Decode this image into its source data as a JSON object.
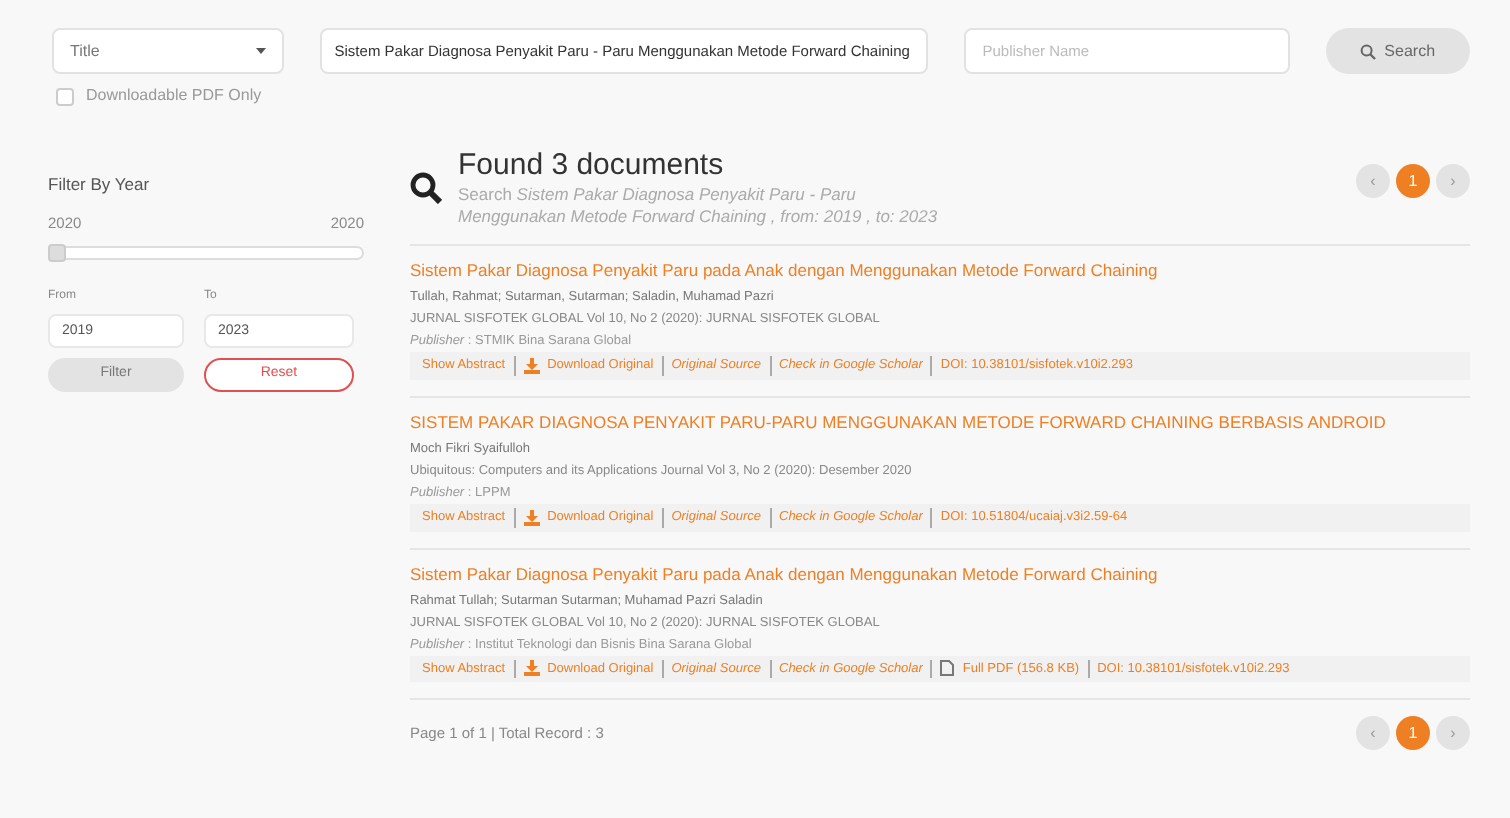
{
  "search_bar": {
    "field_select": "Title",
    "query": "Sistem Pakar Diagnosa Penyakit Paru - Paru Menggunakan Metode Forward Chaining",
    "publisher_placeholder": "Publisher Name",
    "button": "Search"
  },
  "pdf_only": {
    "label": "Downloadable PDF Only",
    "checked": false
  },
  "filter": {
    "title": "Filter By Year",
    "min": "2020",
    "max": "2020",
    "level": 0,
    "from_label": "From",
    "to_label": "To",
    "from": "2019",
    "to": "2023",
    "filter_button": "Filter",
    "reset_button": "Reset"
  },
  "summary": {
    "title": "Found 3 documents",
    "subtitle": "Search *Sistem Pakar Diagnosa Penyakit Paru - Paru Menggunakan Metode Forward Chaining , from: 2019 , to: 2023*"
  },
  "pagination": [
    {
      "label": "‹",
      "selected": false
    },
    {
      "label": "1",
      "selected": true
    },
    {
      "label": "›",
      "selected": false
    }
  ],
  "results": [
    {
      "title": "Sistem Pakar Diagnosa Penyakit Paru pada Anak dengan Menggunakan Metode Forward Chaining",
      "authors": "Tullah, Rahmat; Sutarman, Sutarman; Saladin, Muhamad Pazri",
      "journal": "JURNAL SISFOTEK GLOBAL Vol 10, No 2 (2020): JURNAL SISFOTEK GLOBAL",
      "publisher": "*Publisher* : STMIK Bina Sarana Global",
      "links": [
        {
          "kind": "plain",
          "label": "Show Abstract"
        },
        {
          "kind": "download",
          "label": "Download Original"
        },
        {
          "kind": "italic",
          "label": "Original Source"
        },
        {
          "kind": "italic",
          "label": "Check in Google Scholar"
        },
        {
          "kind": "plain",
          "label": "DOI: 10.38101/sisfotek.v10i2.293"
        }
      ]
    },
    {
      "title": "SISTEM PAKAR DIAGNOSA PENYAKIT PARU-PARU MENGGUNAKAN METODE FORWARD CHAINING BERBASIS ANDROID",
      "authors": "Moch Fikri Syaifulloh",
      "journal": "Ubiquitous: Computers and its Applications Journal Vol 3, No 2 (2020): Desember 2020",
      "publisher": "*Publisher* : LPPM",
      "links": [
        {
          "kind": "plain",
          "label": "Show Abstract"
        },
        {
          "kind": "download",
          "label": "Download Original"
        },
        {
          "kind": "italic",
          "label": "Original Source"
        },
        {
          "kind": "italic",
          "label": "Check in Google Scholar"
        },
        {
          "kind": "plain",
          "label": "DOI: 10.51804/ucaiaj.v3i2.59-64"
        }
      ]
    },
    {
      "title": "Sistem Pakar Diagnosa Penyakit Paru pada Anak dengan Menggunakan Metode Forward Chaining",
      "authors": "Rahmat Tullah; Sutarman Sutarman; Muhamad Pazri Saladin",
      "journal": "JURNAL SISFOTEK GLOBAL Vol 10, No 2 (2020): JURNAL SISFOTEK GLOBAL",
      "publisher": "*Publisher* : Institut Teknologi dan Bisnis Bina Sarana Global",
      "links": [
        {
          "kind": "plain",
          "label": "Show Abstract"
        },
        {
          "kind": "download",
          "label": "Download Original"
        },
        {
          "kind": "italic",
          "label": "Original Source"
        },
        {
          "kind": "italic",
          "label": "Check in Google Scholar"
        },
        {
          "kind": "pdf",
          "label": "Full PDF (156.8 KB)"
        },
        {
          "kind": "plain",
          "label": "DOI: 10.38101/sisfotek.v10i2.293"
        }
      ]
    }
  ],
  "footer": {
    "text": "Page 1 of 1 | Total Record : 3"
  },
  "bottom_pagination": [
    {
      "label": "‹",
      "selected": false
    },
    {
      "label": "1",
      "selected": true
    },
    {
      "label": "›",
      "selected": false
    }
  ]
}
